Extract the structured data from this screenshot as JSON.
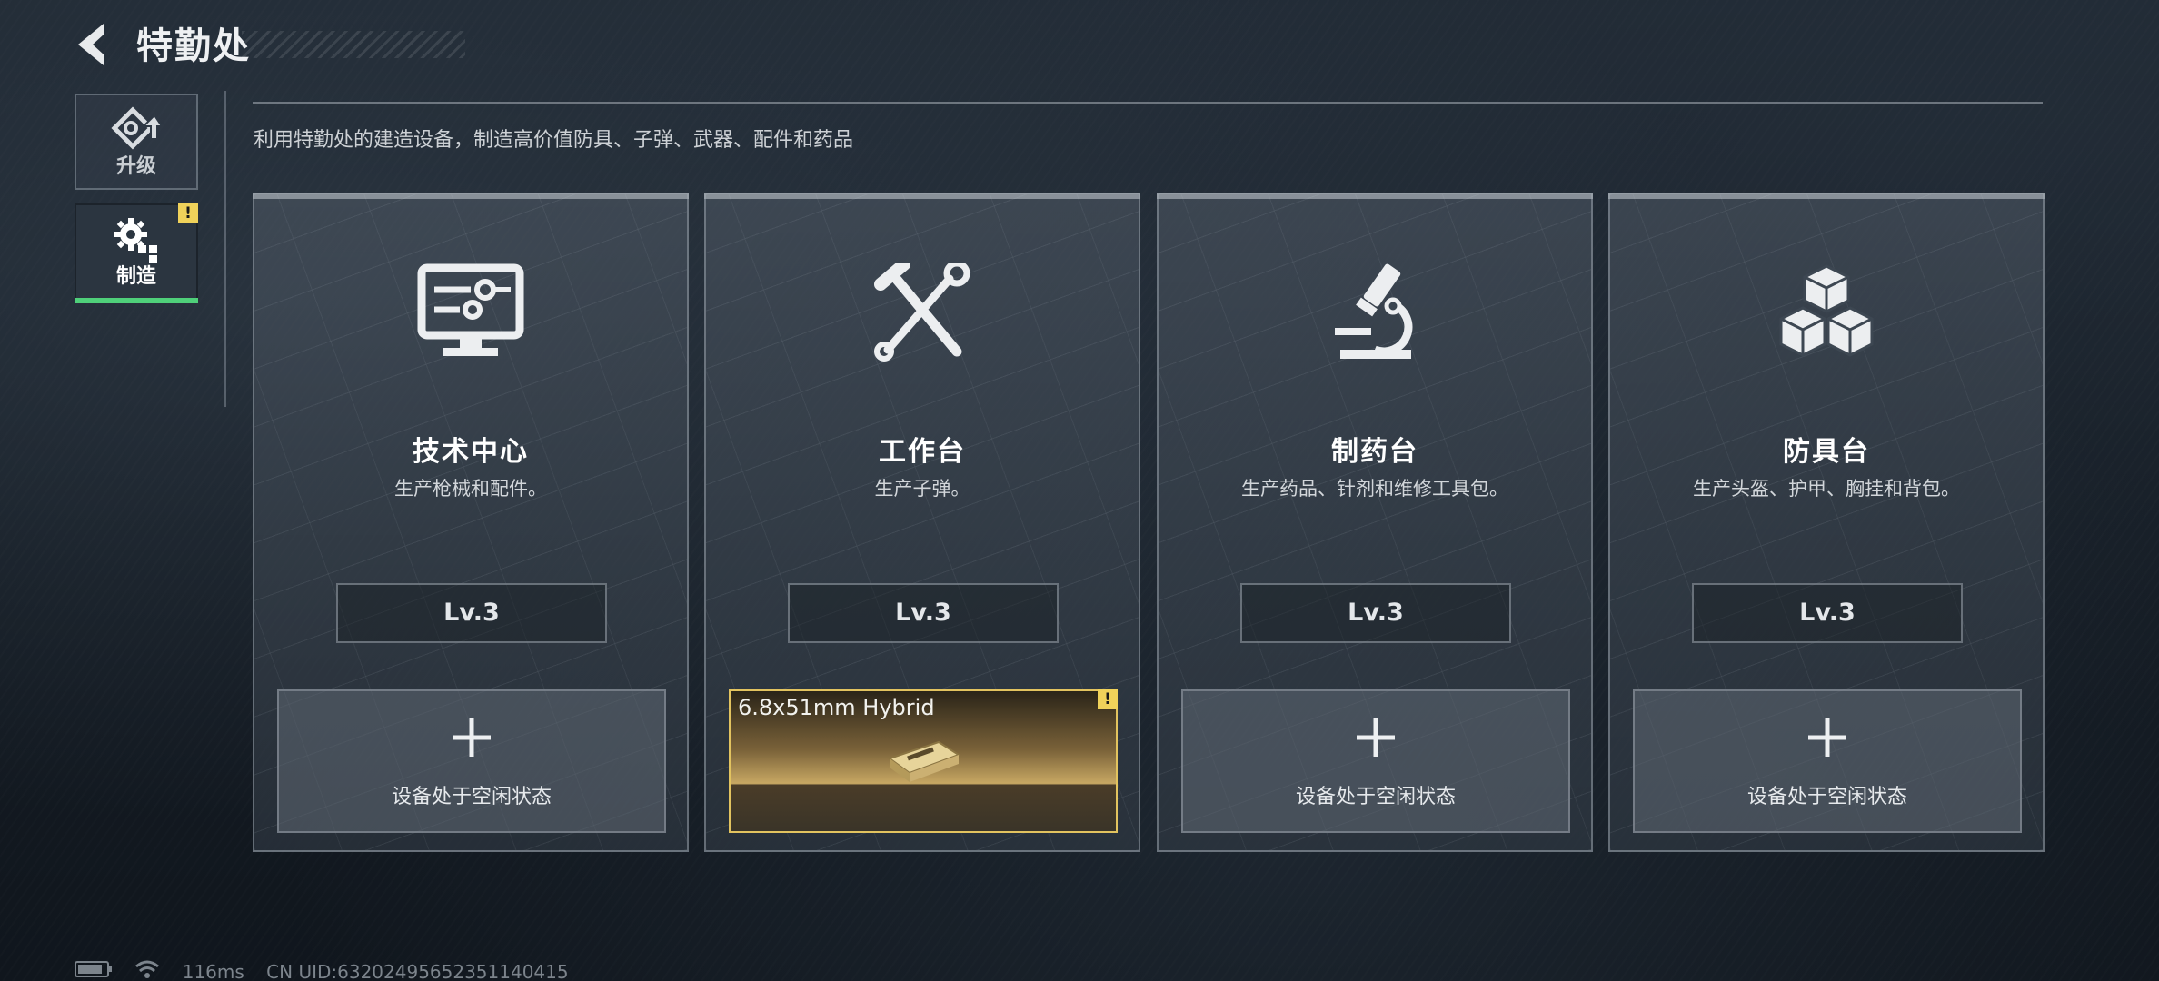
{
  "header": {
    "title": "特勤处",
    "back_icon": "chevron-left-icon"
  },
  "sidebar": {
    "items": [
      {
        "label": "升级",
        "icon": "upgrade-arrow-icon",
        "active": false
      },
      {
        "label": "制造",
        "icon": "gears-icon",
        "active": true,
        "badge": "!"
      }
    ]
  },
  "main": {
    "subtitle": "利用特勤处的建造设备，制造高价值防具、子弹、武器、配件和药品",
    "cards": [
      {
        "name": "技术中心",
        "desc": "生产枪械和配件。",
        "level": "Lv.3",
        "icon": "computer-monitor-icon",
        "slot": {
          "state": "idle",
          "text": "设备处于空闲状态"
        }
      },
      {
        "name": "工作台",
        "desc": "生产子弹。",
        "level": "Lv.3",
        "icon": "hammer-wrench-icon",
        "slot": {
          "state": "active",
          "item": "6.8x51mm Hybrid",
          "badge": "!"
        }
      },
      {
        "name": "制药台",
        "desc": "生产药品、针剂和维修工具包。",
        "level": "Lv.3",
        "icon": "microscope-icon",
        "slot": {
          "state": "idle",
          "text": "设备处于空闲状态"
        }
      },
      {
        "name": "防具台",
        "desc": "生产头盔、护甲、胸挂和背包。",
        "level": "Lv.3",
        "icon": "cubes-icon",
        "slot": {
          "state": "idle",
          "text": "设备处于空闲状态"
        }
      }
    ]
  },
  "status": {
    "ping": "116ms",
    "uid": "CN UID:63202495652351140415"
  },
  "colors": {
    "accent_green": "#4fd07a",
    "warning_yellow": "#f0d25a",
    "active_slot_gold": "#e2c35f"
  }
}
